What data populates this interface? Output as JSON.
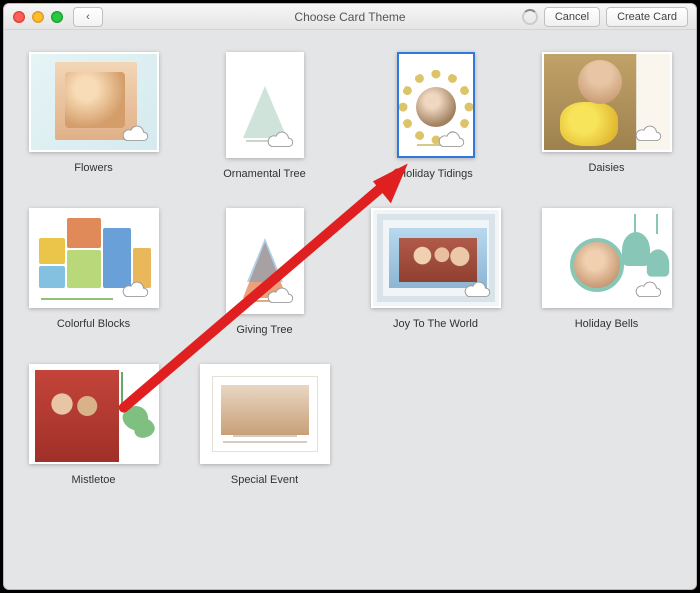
{
  "titlebar": {
    "title": "Choose Card Theme",
    "back_glyph": "‹",
    "cancel_label": "Cancel",
    "create_label": "Create Card"
  },
  "selected_index": 2,
  "cards": [
    {
      "label": "Flowers"
    },
    {
      "label": "Ornamental Tree"
    },
    {
      "label": "Holiday Tidings"
    },
    {
      "label": "Daisies"
    },
    {
      "label": "Colorful Blocks"
    },
    {
      "label": "Giving Tree"
    },
    {
      "label": "Joy To The World"
    },
    {
      "label": "Holiday Bells"
    },
    {
      "label": "Mistletoe"
    },
    {
      "label": "Special Event"
    }
  ]
}
